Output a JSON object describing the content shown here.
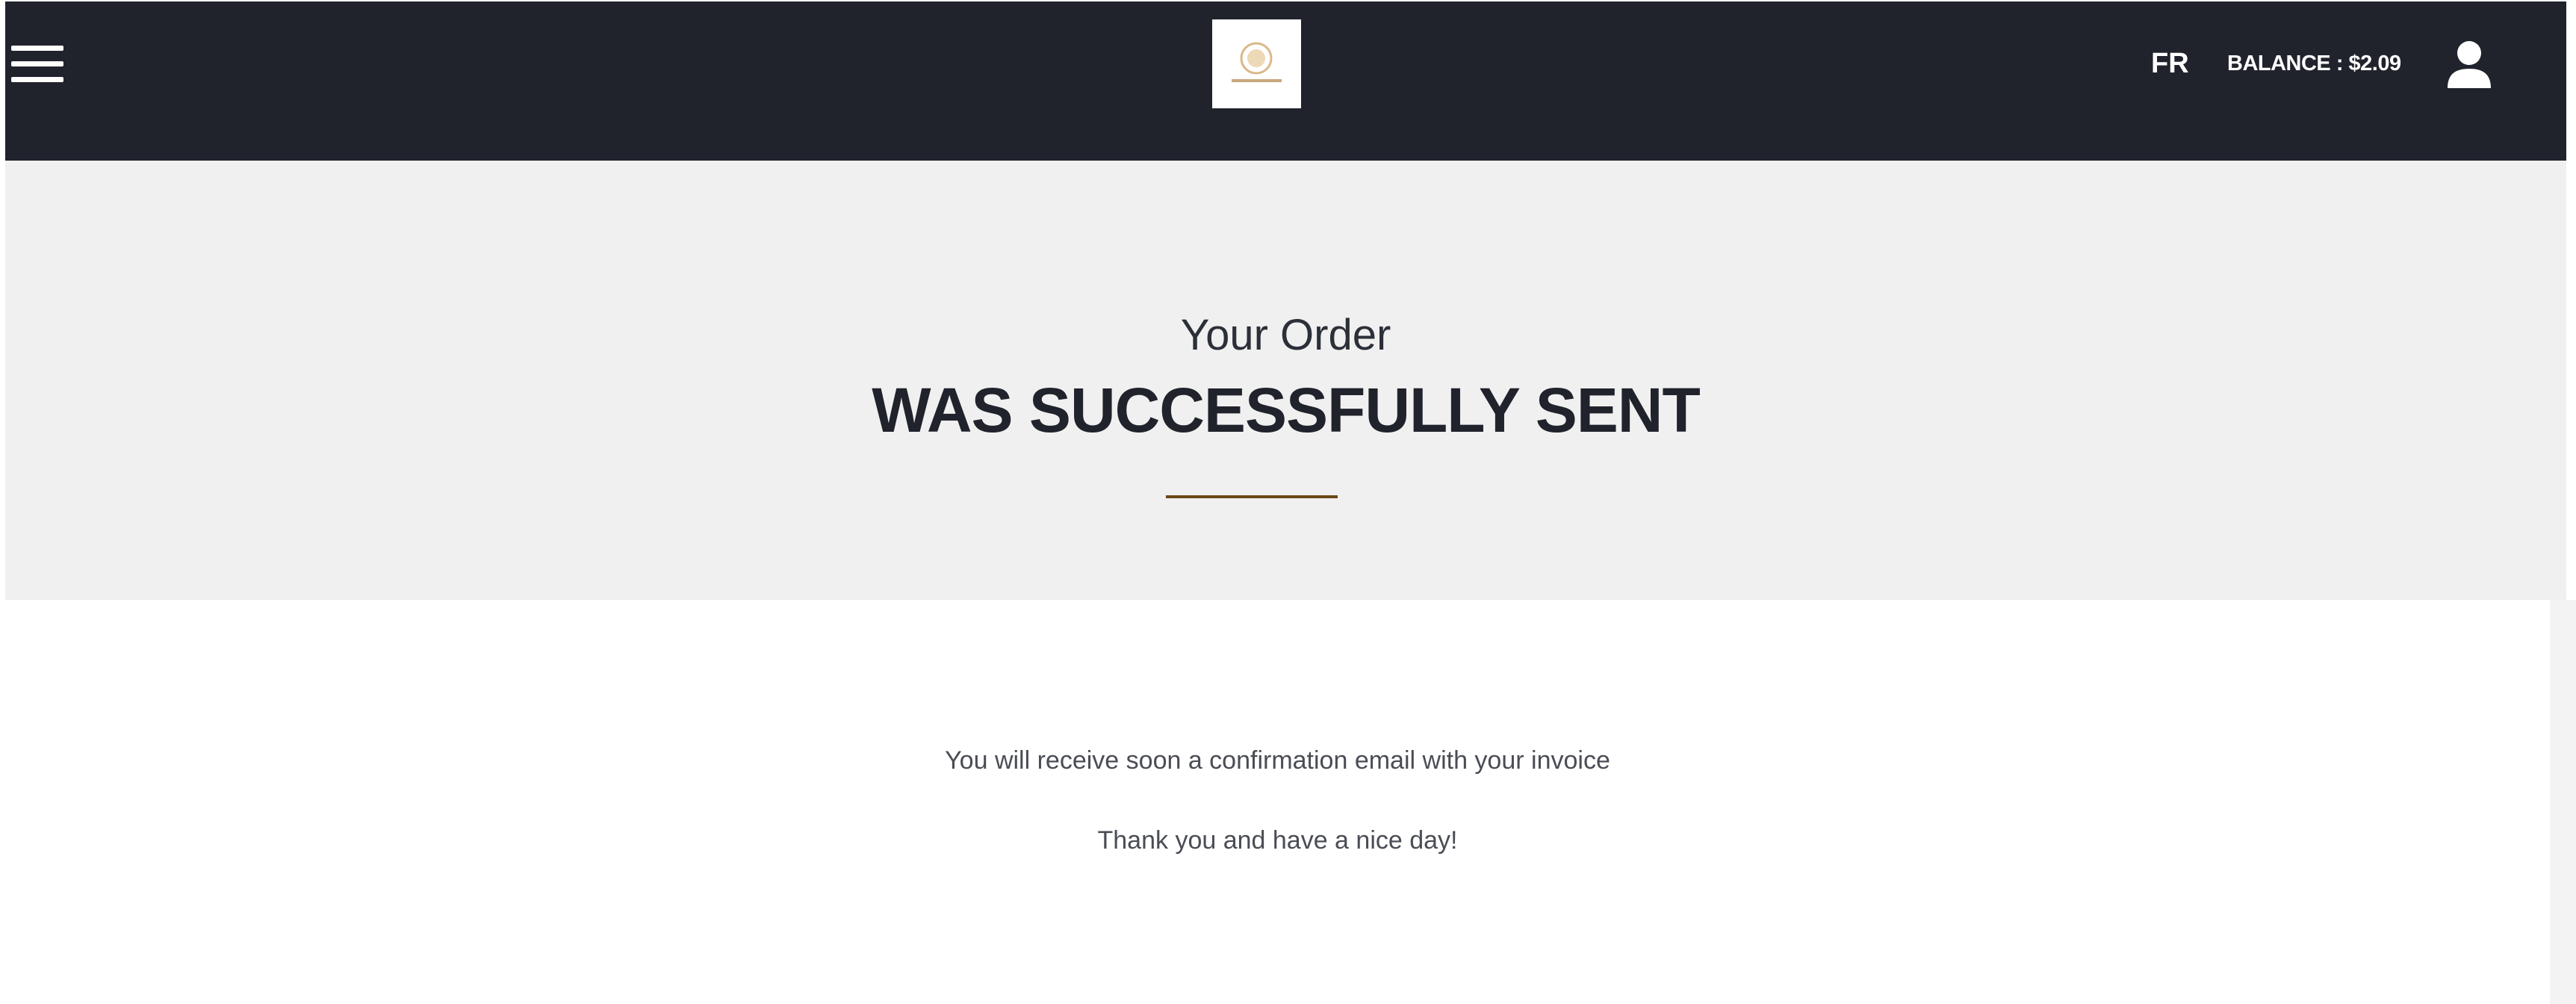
{
  "header": {
    "language": "FR",
    "balance": "BALANCE : $2.09",
    "menu_icon": "hamburger-menu-icon",
    "user_icon": "user-icon",
    "logo_icon": "brand-logo"
  },
  "hero": {
    "subtitle": "Your Order",
    "title": "WAS SUCCESSFULLY SENT"
  },
  "content": {
    "line1": "You will receive soon a confirmation email with your invoice",
    "line2": "Thank you and have a nice day!"
  },
  "colors": {
    "header_bg": "#20232c",
    "hero_bg": "#f0f0f0",
    "accent_rule": "#6b4714"
  }
}
